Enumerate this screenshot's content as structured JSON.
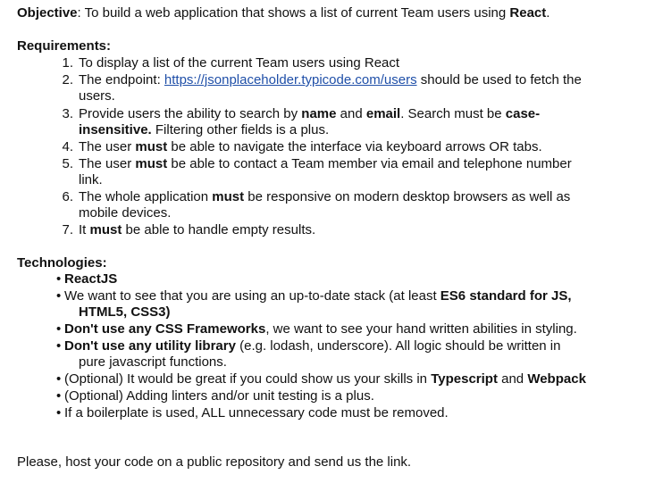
{
  "objective": {
    "label": "Objective",
    "text_before": ": To build a web application that shows a list of current Team users using ",
    "react": "React",
    "text_after": "."
  },
  "requirements": {
    "heading": "Requirements:",
    "items": [
      {
        "num": "1.",
        "text": "To display a list of the current Team users using React"
      },
      {
        "num": "2.",
        "pre": "The endpoint: ",
        "link": "https://jsonplaceholder.typicode.com/users",
        "post": " should be used to fetch the",
        "cont": "users."
      },
      {
        "num": "3.",
        "pre": "Provide users the ability to search by ",
        "b1": "name",
        "mid": " and ",
        "b2": "email",
        "mid2": ". Search must be ",
        "b3": "case-",
        "cont_b": "insensitive.",
        "cont_rest": " Filtering other fields is a plus."
      },
      {
        "num": "4.",
        "pre": "The user ",
        "b1": "must",
        "post": " be able to navigate the interface via keyboard arrows OR tabs."
      },
      {
        "num": "5.",
        "pre": "The user ",
        "b1": "must",
        "post": " be able to contact a Team member via email and telephone number",
        "cont": "link."
      },
      {
        "num": "6.",
        "pre": "The whole application ",
        "b1": "must",
        "post": " be responsive on modern desktop browsers as well as",
        "cont": "mobile devices."
      },
      {
        "num": "7.",
        "pre": "It ",
        "b1": "must",
        "post": " be able to handle empty results."
      }
    ]
  },
  "technologies": {
    "heading": "Technologies:",
    "bullet_char": "•",
    "items": [
      {
        "b1": "ReactJS"
      },
      {
        "pre": "We want to see that you are using an up-to-date stack (at least ",
        "b1": "ES6 standard for JS,",
        "cont_b": "HTML5, CSS3)"
      },
      {
        "b1": "Don't use any CSS Frameworks",
        "post": ", we want to see your hand written abilities in styling."
      },
      {
        "b1": "Don't use any utility library",
        "post": " (e.g. lodash, underscore). All logic should be written in",
        "cont": "pure javascript functions."
      },
      {
        "pre": "(Optional) It would be great if you could show us your skills in ",
        "b1": "Typescript",
        "mid": " and ",
        "b2": "Webpack"
      },
      {
        "pre": "(Optional) Adding linters and/or unit testing is a plus."
      },
      {
        "pre": "If a boilerplate is used, ALL unnecessary code must be removed."
      }
    ]
  },
  "footer": {
    "text": "Please, host your code on a public repository and send us the link."
  }
}
